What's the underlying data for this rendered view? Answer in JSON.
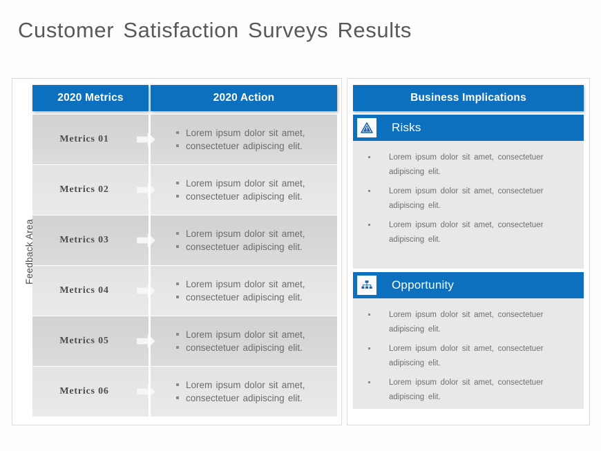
{
  "title": "Customer  Satisfaction  Surveys  Results",
  "colors": {
    "accent_blue": "#0d70be",
    "title_text": "#58595b",
    "row_dark": "#d6d6d6",
    "row_light": "#e6e6e6",
    "section_bg": "#e8e8e8",
    "page_bg": "#fdfdfd"
  },
  "left_panel": {
    "side_label": "Feedback Area",
    "headers": {
      "metrics": "2020 Metrics",
      "action": "2020 Action"
    },
    "rows": [
      {
        "metric": "Metrics  01",
        "bullets": [
          "Lorem  ipsum dolor sit amet,",
          "consectetuer adipiscing elit."
        ]
      },
      {
        "metric": "Metrics  02",
        "bullets": [
          "Lorem  ipsum dolor sit amet,",
          "consectetuer adipiscing elit."
        ]
      },
      {
        "metric": "Metrics  03",
        "bullets": [
          "Lorem  ipsum dolor sit amet,",
          "consectetuer adipiscing elit."
        ]
      },
      {
        "metric": "Metrics  04",
        "bullets": [
          "Lorem  ipsum dolor sit amet,",
          "consectetuer adipiscing elit."
        ]
      },
      {
        "metric": "Metrics  05",
        "bullets": [
          "Lorem  ipsum dolor sit amet,",
          "consectetuer adipiscing elit."
        ]
      },
      {
        "metric": "Metrics  06",
        "bullets": [
          "Lorem  ipsum dolor sit amet,",
          "consectetuer adipiscing elit."
        ]
      }
    ]
  },
  "right_panel": {
    "title": "Business Implications",
    "sections": [
      {
        "label": "Risks",
        "icon": "warning-triangle-icon",
        "bullets": [
          "Lorem  ipsum  dolor  sit amet, consectetuer adipiscing  elit.",
          "Lorem  ipsum  dolor  sit amet, consectetuer adipiscing  elit.",
          "Lorem  ipsum  dolor  sit amet, consectetuer adipiscing  elit."
        ]
      },
      {
        "label": "Opportunity",
        "icon": "org-chart-icon",
        "bullets": [
          "Lorem  ipsum  dolor  sit amet, consectetuer adipiscing  elit.",
          "Lorem  ipsum  dolor  sit amet, consectetuer adipiscing  elit.",
          "Lorem  ipsum  dolor  sit amet, consectetuer adipiscing  elit."
        ]
      }
    ]
  }
}
